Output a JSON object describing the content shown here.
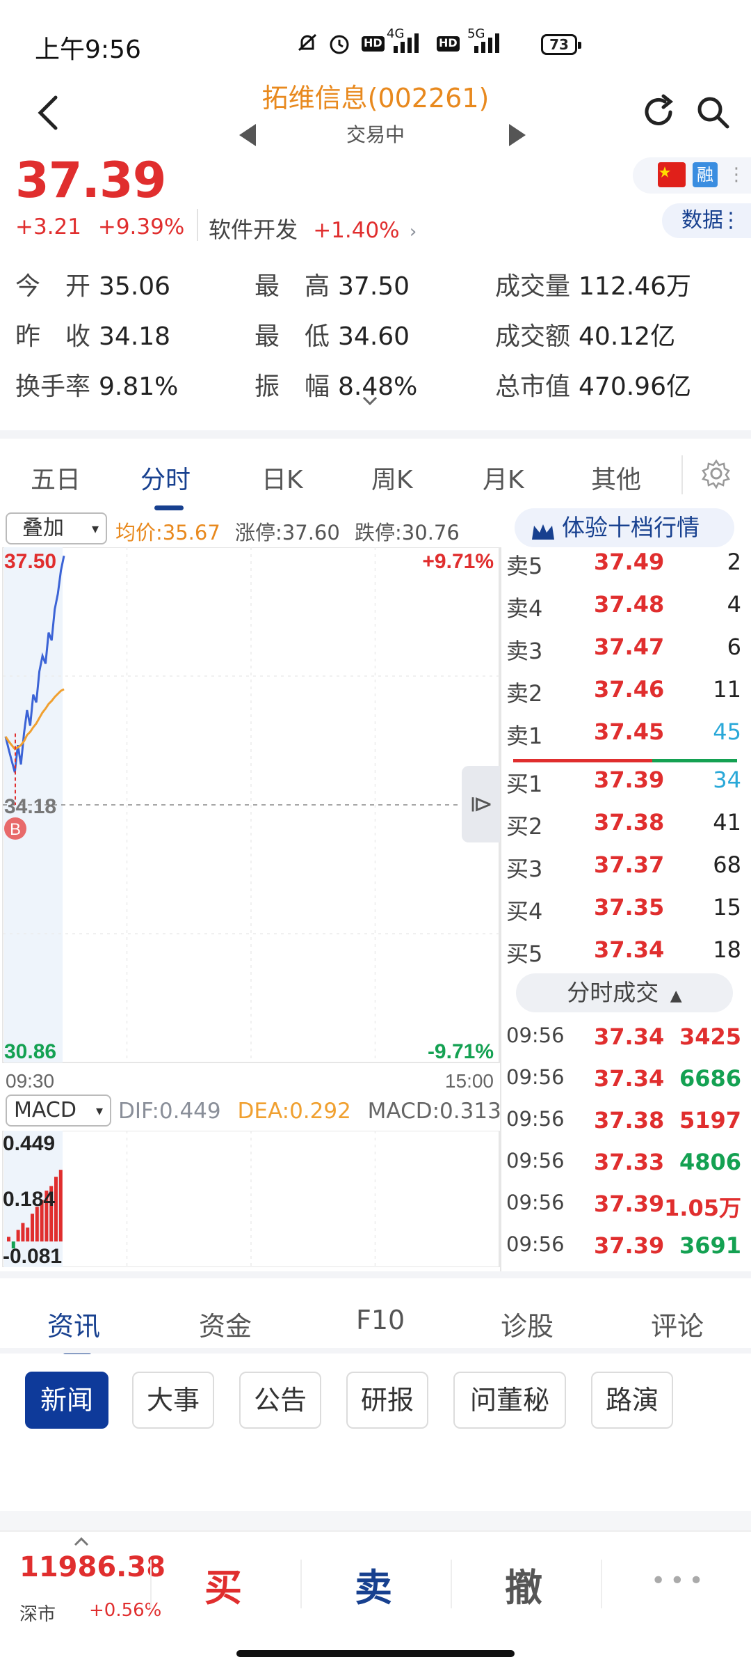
{
  "status_bar": {
    "time": "上午9:56",
    "net1": "4G",
    "net2": "5G",
    "battery": "73"
  },
  "header": {
    "title": "拓维信息(002261)",
    "status": "交易中"
  },
  "quote": {
    "price": "37.39",
    "change": "+3.21",
    "change_pct": "+9.39%",
    "sector_name": "软件开发",
    "sector_pct": "+1.40%",
    "rong": "融",
    "data_btn": "数据"
  },
  "stats": [
    {
      "label": "今　开",
      "value": "35.06"
    },
    {
      "label": "最　高",
      "value": "37.50"
    },
    {
      "label": "成交量",
      "value": "112.46万"
    },
    {
      "label": "昨　收",
      "value": "34.18"
    },
    {
      "label": "最　低",
      "value": "34.60"
    },
    {
      "label": "成交额",
      "value": "40.12亿"
    },
    {
      "label": "换手率",
      "value": "9.81%"
    },
    {
      "label": "振　幅",
      "value": "8.48%"
    },
    {
      "label": "总市值",
      "value": "470.96亿"
    }
  ],
  "chart_tabs": [
    "五日",
    "分时",
    "日K",
    "周K",
    "月K",
    "其他"
  ],
  "chart_tabs_active": "分时",
  "chart_legend": {
    "overlay": "叠加",
    "avg": "均价:35.67",
    "limit_up": "涨停:37.60",
    "limit_down": "跌停:30.76",
    "ten_level": "体验十档行情"
  },
  "chart_data": {
    "type": "line",
    "title": "",
    "x_range": [
      "09:30",
      "15:00"
    ],
    "y_range": [
      30.86,
      37.5
    ],
    "prev_close": 34.18,
    "pct_top": "+9.71%",
    "pct_bottom": "-9.71%",
    "y_top_label": "37.50",
    "y_mid_label": "34.18",
    "y_bot_label": "30.86",
    "x_start_label": "09:30",
    "x_end_label": "15:00",
    "marker": "B",
    "series": [
      {
        "name": "价格",
        "color": "#3b63d6",
        "values": [
          35.06,
          34.9,
          34.75,
          34.6,
          34.95,
          34.7,
          35.1,
          35.4,
          35.2,
          35.6,
          35.5,
          35.9,
          36.1,
          36.0,
          36.4,
          36.3,
          36.7,
          36.9,
          37.2,
          37.39
        ]
      },
      {
        "name": "均价",
        "color": "#f0a030",
        "values": [
          35.06,
          35.0,
          34.95,
          34.9,
          34.92,
          34.95,
          35.0,
          35.08,
          35.12,
          35.18,
          35.23,
          35.3,
          35.37,
          35.42,
          35.48,
          35.52,
          35.57,
          35.61,
          35.65,
          35.67
        ]
      }
    ]
  },
  "macd": {
    "selector": "MACD",
    "dif": "DIF:0.449",
    "dea": "DEA:0.292",
    "macd": "MACD:0.313",
    "top": "0.449",
    "mid": "0.184",
    "bot": "-0.081",
    "bars": [
      0.02,
      -0.03,
      0.05,
      0.08,
      0.06,
      0.12,
      0.15,
      0.18,
      0.22,
      0.24,
      0.28,
      0.31
    ]
  },
  "order_book": {
    "asks": [
      {
        "label": "卖5",
        "price": "37.49",
        "qty": "2"
      },
      {
        "label": "卖4",
        "price": "37.48",
        "qty": "4"
      },
      {
        "label": "卖3",
        "price": "37.47",
        "qty": "6"
      },
      {
        "label": "卖2",
        "price": "37.46",
        "qty": "11"
      },
      {
        "label": "卖1",
        "price": "37.45",
        "qty": "45"
      }
    ],
    "bids": [
      {
        "label": "买1",
        "price": "37.39",
        "qty": "34"
      },
      {
        "label": "买2",
        "price": "37.38",
        "qty": "41"
      },
      {
        "label": "买3",
        "price": "37.37",
        "qty": "68"
      },
      {
        "label": "买4",
        "price": "37.35",
        "qty": "15"
      },
      {
        "label": "买5",
        "price": "37.34",
        "qty": "18"
      }
    ]
  },
  "trades_title": "分时成交",
  "trades": [
    {
      "time": "09:56",
      "price": "37.34",
      "qty": "3425",
      "dir": "red"
    },
    {
      "time": "09:56",
      "price": "37.34",
      "qty": "6686",
      "dir": "green"
    },
    {
      "time": "09:56",
      "price": "37.38",
      "qty": "5197",
      "dir": "red"
    },
    {
      "time": "09:56",
      "price": "37.33",
      "qty": "4806",
      "dir": "green"
    },
    {
      "time": "09:56",
      "price": "37.39",
      "qty": "1.05万",
      "dir": "red"
    },
    {
      "time": "09:56",
      "price": "37.39",
      "qty": "3691",
      "dir": "green"
    }
  ],
  "info_tabs": [
    "资讯",
    "资金",
    "F10",
    "诊股",
    "评论"
  ],
  "info_tabs_active": "资讯",
  "chips": [
    "新闻",
    "大事",
    "公告",
    "研报",
    "问董秘",
    "路演"
  ],
  "bottom": {
    "index_value": "11986.38",
    "index_name": "深市",
    "index_pct": "+0.56%",
    "buy": "买",
    "sell": "卖",
    "cancel": "撤"
  },
  "colors": {
    "up": "#e02e2e",
    "down": "#14a152",
    "brand": "#17408f",
    "avg": "#f0a030"
  }
}
